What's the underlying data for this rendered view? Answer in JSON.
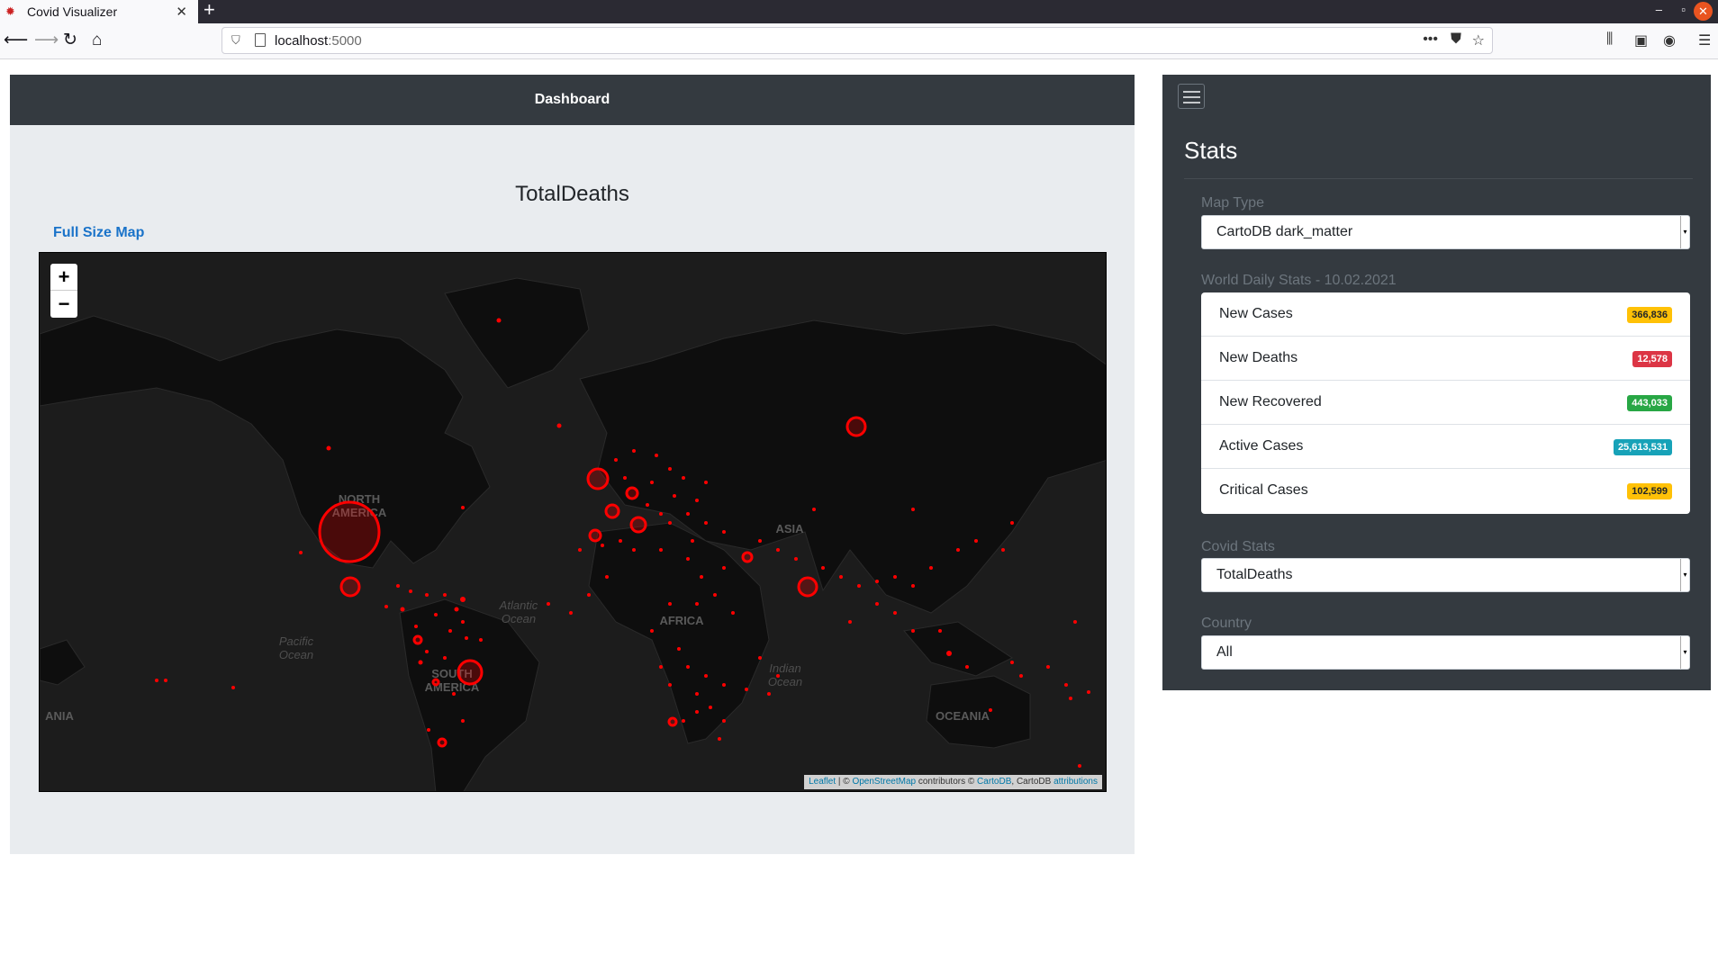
{
  "browser": {
    "tab_title": "Covid Visualizer",
    "url_host": "localhost",
    "url_port": ":5000"
  },
  "dashboard": {
    "header": "Dashboard",
    "map_title": "TotalDeaths",
    "full_size_link": "Full Size Map",
    "map": {
      "labels": [
        "NORTH",
        "AMERICA",
        "SOUTH",
        "AMERICA",
        "AFRICA",
        "ASIA",
        "OCEANIA",
        "ANIA",
        "Atlantic",
        "Ocean",
        "Pacific",
        "Ocean",
        "Indian",
        "Ocean"
      ],
      "zoom_in": "+",
      "zoom_out": "−",
      "attribution": {
        "leaflet": "Leaflet",
        "sep1": " | © ",
        "osm": "OpenStreetMap",
        "contrib": " contributors © ",
        "cartodb": "CartoDB",
        "mid": ", CartoDB ",
        "attributions": "attributions"
      }
    }
  },
  "stats": {
    "title": "Stats",
    "map_type_label": "Map Type",
    "map_type_value": "CartoDB dark_matter",
    "daily_label": "World Daily Stats - 10.02.2021",
    "daily_items": [
      {
        "name": "New Cases",
        "value": "366,836",
        "color": "#ffc107",
        "text_color": "#212529"
      },
      {
        "name": "New Deaths",
        "value": "12,578",
        "color": "#dc3545",
        "text_color": "#ffffff"
      },
      {
        "name": "New Recovered",
        "value": "443,033",
        "color": "#28a745",
        "text_color": "#ffffff"
      },
      {
        "name": "Active Cases",
        "value": "25,613,531",
        "color": "#17a2b8",
        "text_color": "#ffffff"
      },
      {
        "name": "Critical Cases",
        "value": "102,599",
        "color": "#ffc107",
        "text_color": "#212529"
      }
    ],
    "covid_stats_label": "Covid Stats",
    "covid_stats_value": "TotalDeaths",
    "country_label": "Country",
    "country_value": "All"
  },
  "colors": {
    "marker": "#ff0000",
    "map_bg": "#1c1c1c",
    "land": "#0e0e0e",
    "panel_dark": "#343a40",
    "panel_light": "#e9ecef",
    "link": "#1a73c9"
  }
}
